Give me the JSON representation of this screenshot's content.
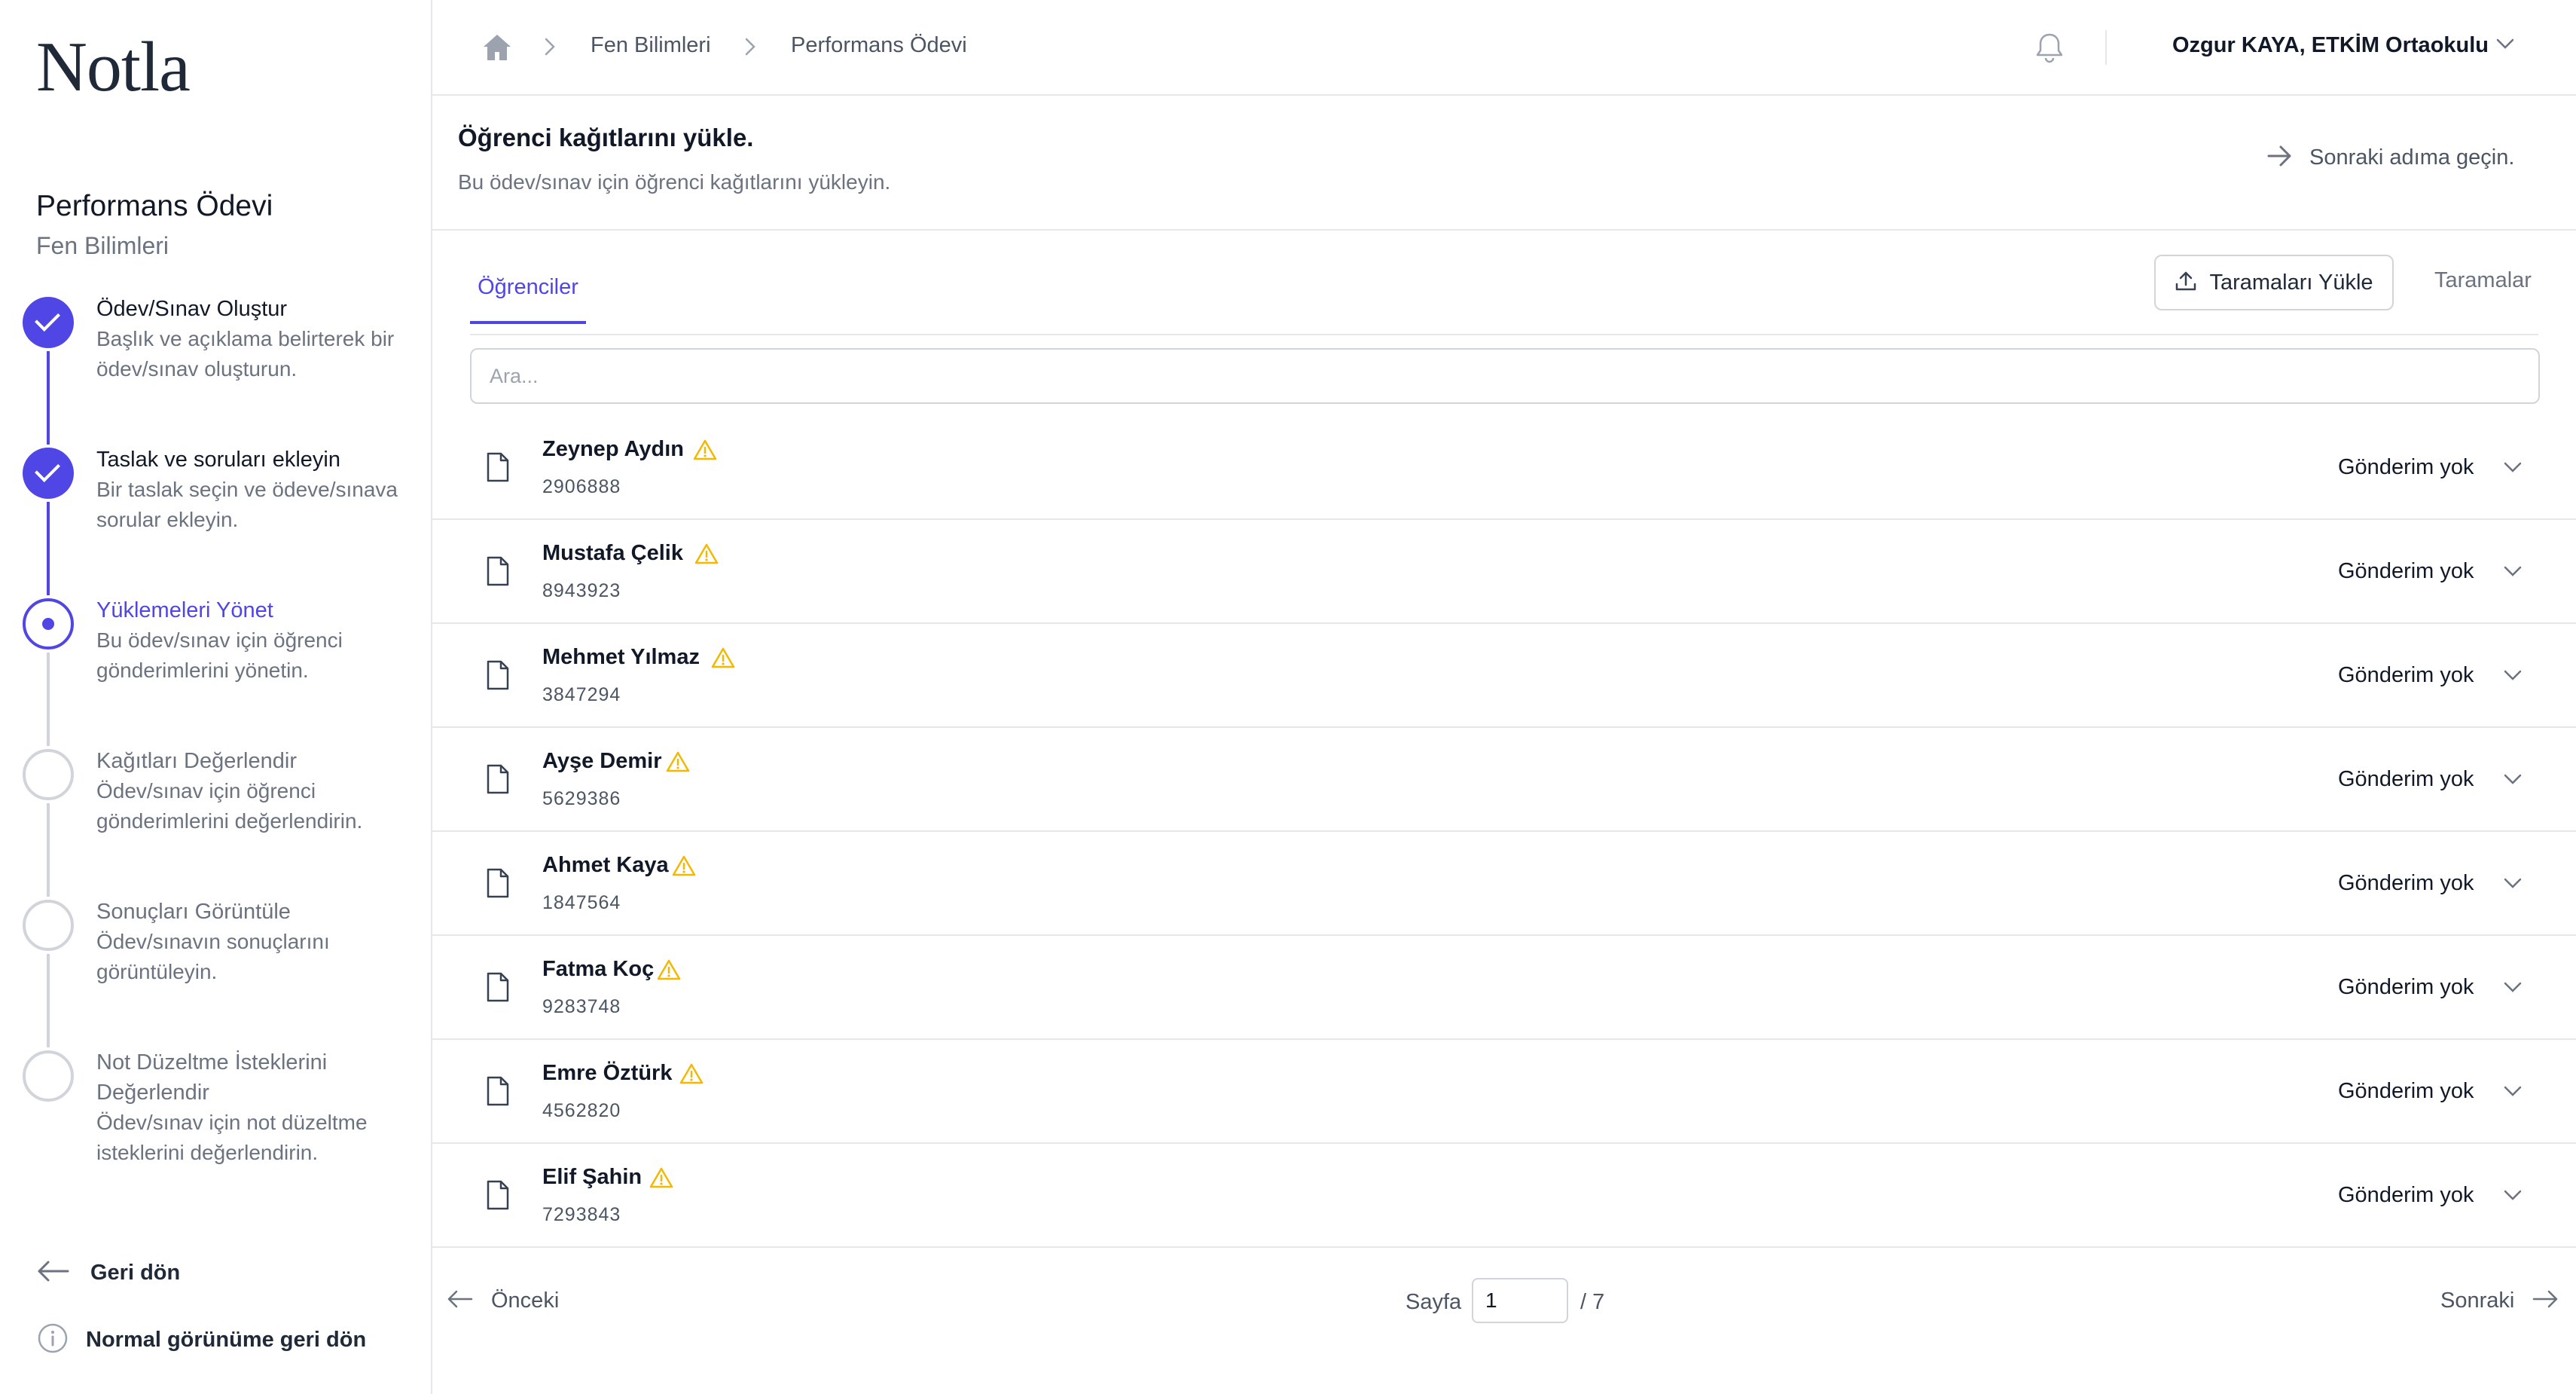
{
  "app": {
    "logo": "Notla"
  },
  "assignment": {
    "title": "Performans Ödevi",
    "subject": "Fen Bilimleri"
  },
  "steps": [
    {
      "title": "Ödev/Sınav Oluştur",
      "desc": "Başlık ve açıklama belirterek bir ödev/sınav oluşturun.",
      "state": "done"
    },
    {
      "title": "Taslak ve soruları ekleyin",
      "desc": "Bir taslak seçin ve ödeve/sınava sorular ekleyin.",
      "state": "done"
    },
    {
      "title": "Yüklemeleri Yönet",
      "desc": "Bu ödev/sınav için öğrenci gönderimlerini yönetin.",
      "state": "current"
    },
    {
      "title": "Kağıtları Değerlendir",
      "desc": "Ödev/sınav için öğrenci gönderimlerini değerlendirin.",
      "state": "todo"
    },
    {
      "title": "Sonuçları Görüntüle",
      "desc": "Ödev/sınavın sonuçlarını görüntüleyin.",
      "state": "todo"
    },
    {
      "title": "Not Düzeltme İsteklerini Değerlendir",
      "desc": "Ödev/sınav için not düzeltme isteklerini değerlendirin.",
      "state": "todo"
    }
  ],
  "sidebar_links": {
    "back": "Geri dön",
    "normal_view": "Normal görünüme geri dön"
  },
  "breadcrumb": {
    "items": [
      "Fen Bilimleri",
      "Performans Ödevi"
    ]
  },
  "user": {
    "name": "Ozgur KAYA, ETKİM Ortaokulu"
  },
  "header": {
    "title": "Öğrenci kağıtlarını yükle.",
    "subtitle": "Bu ödev/sınav için öğrenci kağıtlarını yükleyin.",
    "next_step": "Sonraki adıma geçin."
  },
  "tabs": {
    "students": "Öğrenciler",
    "scans": "Taramalar",
    "upload_button": "Taramaları Yükle"
  },
  "search": {
    "placeholder": "Ara...",
    "value": ""
  },
  "students": [
    {
      "name": "Zeynep Aydın",
      "id": "2906888",
      "status": "Gönderim yok"
    },
    {
      "name": "Mustafa Çelik",
      "id": "8943923",
      "status": "Gönderim yok"
    },
    {
      "name": "Mehmet Yılmaz",
      "id": "3847294",
      "status": "Gönderim yok"
    },
    {
      "name": "Ayşe Demir",
      "id": "5629386",
      "status": "Gönderim yok"
    },
    {
      "name": "Ahmet Kaya",
      "id": "1847564",
      "status": "Gönderim yok"
    },
    {
      "name": "Fatma Koç",
      "id": "9283748",
      "status": "Gönderim yok"
    },
    {
      "name": "Emre Öztürk",
      "id": "4562820",
      "status": "Gönderim yok"
    },
    {
      "name": "Elif Şahin",
      "id": "7293843",
      "status": "Gönderim yok"
    }
  ],
  "pagination": {
    "prev": "Önceki",
    "page_label": "Sayfa",
    "current": "1",
    "total": "/ 7",
    "next": "Sonraki"
  },
  "colors": {
    "accent": "#4f46e5",
    "warning": "#f5b800",
    "border": "#e5e7eb",
    "muted": "#6b7280"
  },
  "icons": {
    "home": "home-icon",
    "breadcrumb_sep": "chevron-right-icon",
    "bell": "bell-icon",
    "user_menu": "chevron-down-icon",
    "next_step": "arrow-right-icon",
    "upload": "upload-icon",
    "file": "file-icon",
    "warning": "warning-triangle-icon",
    "row_expand": "chevron-down-icon",
    "back": "arrow-left-icon",
    "info": "info-circle-icon"
  }
}
